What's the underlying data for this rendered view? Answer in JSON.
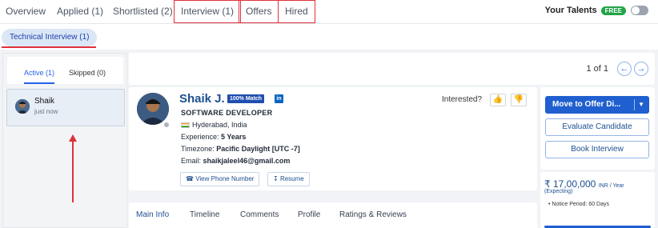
{
  "tabs": [
    {
      "label": "Overview"
    },
    {
      "label": "Applied (1)"
    },
    {
      "label": "Shortlisted (2)"
    },
    {
      "label": "Interview (1)"
    },
    {
      "label": "Offers"
    },
    {
      "label": "Hired"
    }
  ],
  "talents": {
    "label": "Your Talents",
    "badge": "FREE"
  },
  "subtab": {
    "label": "Technical Interview (1)"
  },
  "list_tabs": {
    "active": "Active (1)",
    "skipped": "Skipped (0)"
  },
  "candidate_list": [
    {
      "name": "Shaik",
      "time": "just now"
    }
  ],
  "pager": {
    "text": "1 of 1",
    "prev": "←",
    "next": "→"
  },
  "profile": {
    "name": "Shaik J.",
    "match": "100% Match",
    "linkedin": "in",
    "title": "SOFTWARE DEVELOPER",
    "location": "Hyderabad, India",
    "experience_label": "Experience:",
    "experience_value": "5 Years",
    "timezone_label": "Timezone:",
    "timezone_value": "Pacific Daylight [UTC -7]",
    "email_label": "Email:",
    "email_value": "shaikjaleel46@gmail.com",
    "phone_button": "View Phone Number",
    "resume_button": "Resume",
    "interested_label": "Interested?"
  },
  "detail_tabs": [
    "Main Info",
    "Timeline",
    "Comments",
    "Profile",
    "Ratings & Reviews"
  ],
  "actions": {
    "move": "Move to Offer Di...",
    "evaluate": "Evaluate Candidate",
    "book": "Book Interview"
  },
  "salary": {
    "amount": "₹ 17,00,000",
    "unit": "INR / Year",
    "note": "(Expecting)",
    "notice": "Notice Period: 60 Days"
  },
  "colors": {
    "accent": "#1f5fcf",
    "annotation": "#e0313b",
    "badge_green": "#22a447"
  }
}
